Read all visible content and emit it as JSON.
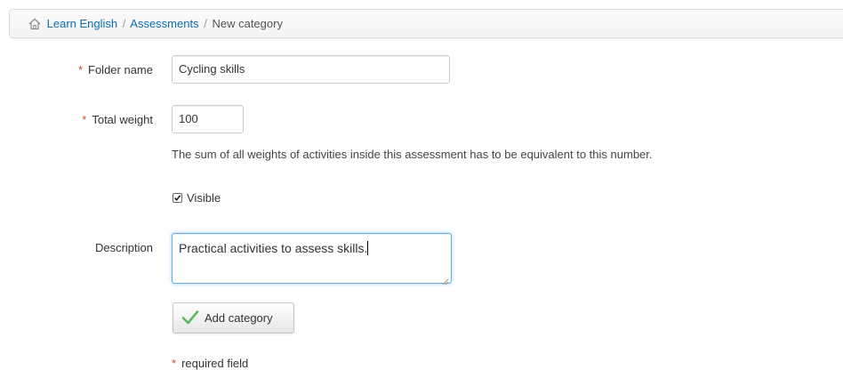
{
  "breadcrumb": {
    "items": [
      {
        "label": "Learn English"
      },
      {
        "label": "Assessments"
      },
      {
        "label": "New category"
      }
    ],
    "separator": "/"
  },
  "form": {
    "required_mark": "*",
    "folder_name": {
      "label": "Folder name",
      "value": "Cycling skills"
    },
    "total_weight": {
      "label": "Total weight",
      "value": "100",
      "help": "The sum of all weights of activities inside this assessment has to be equivalent to this number."
    },
    "visible": {
      "label": "Visible",
      "checked": true
    },
    "description": {
      "label": "Description",
      "value": "Practical activities to assess skills."
    },
    "submit_label": "Add category",
    "required_note": "required field"
  },
  "colors": {
    "link": "#0b6fb3",
    "required": "#d14836",
    "focus": "#66afe9",
    "check_icon": "#5cb85c"
  },
  "icons": {
    "home": "home-icon",
    "submit": "checkmark-icon",
    "checkbox": "checkbox-checked-icon"
  }
}
